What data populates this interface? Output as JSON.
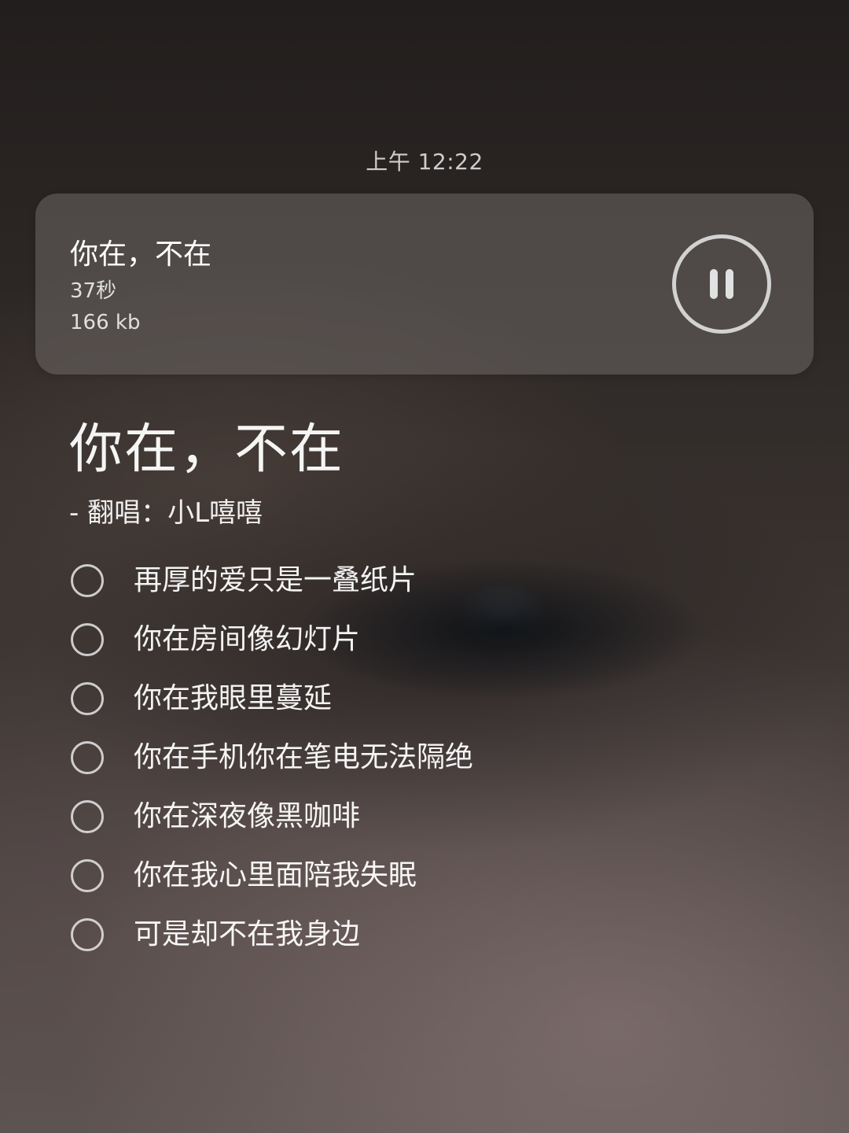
{
  "status_bar": {
    "time": "上午 12:22"
  },
  "audio_card": {
    "title": "你在，不在",
    "duration": "37秒",
    "size": "166 kb",
    "state": "playing",
    "control_icon": "pause-icon"
  },
  "song": {
    "title": "你在，不在",
    "artist_line": "-   翻唱：小L嘻嘻"
  },
  "lyrics": [
    {
      "text": "再厚的爱只是一叠纸片",
      "checked": false
    },
    {
      "text": "你在房间像幻灯片",
      "checked": false
    },
    {
      "text": "你在我眼里蔓延",
      "checked": false
    },
    {
      "text": "你在手机你在笔电无法隔绝",
      "checked": false
    },
    {
      "text": "你在深夜像黑咖啡",
      "checked": false
    },
    {
      "text": "你在我心里面陪我失眠",
      "checked": false
    },
    {
      "text": "可是却不在我身边",
      "checked": false
    }
  ],
  "colors": {
    "card_background": "#6e6866",
    "text": "#ffffff",
    "control_ring": "#e1e1e1"
  }
}
